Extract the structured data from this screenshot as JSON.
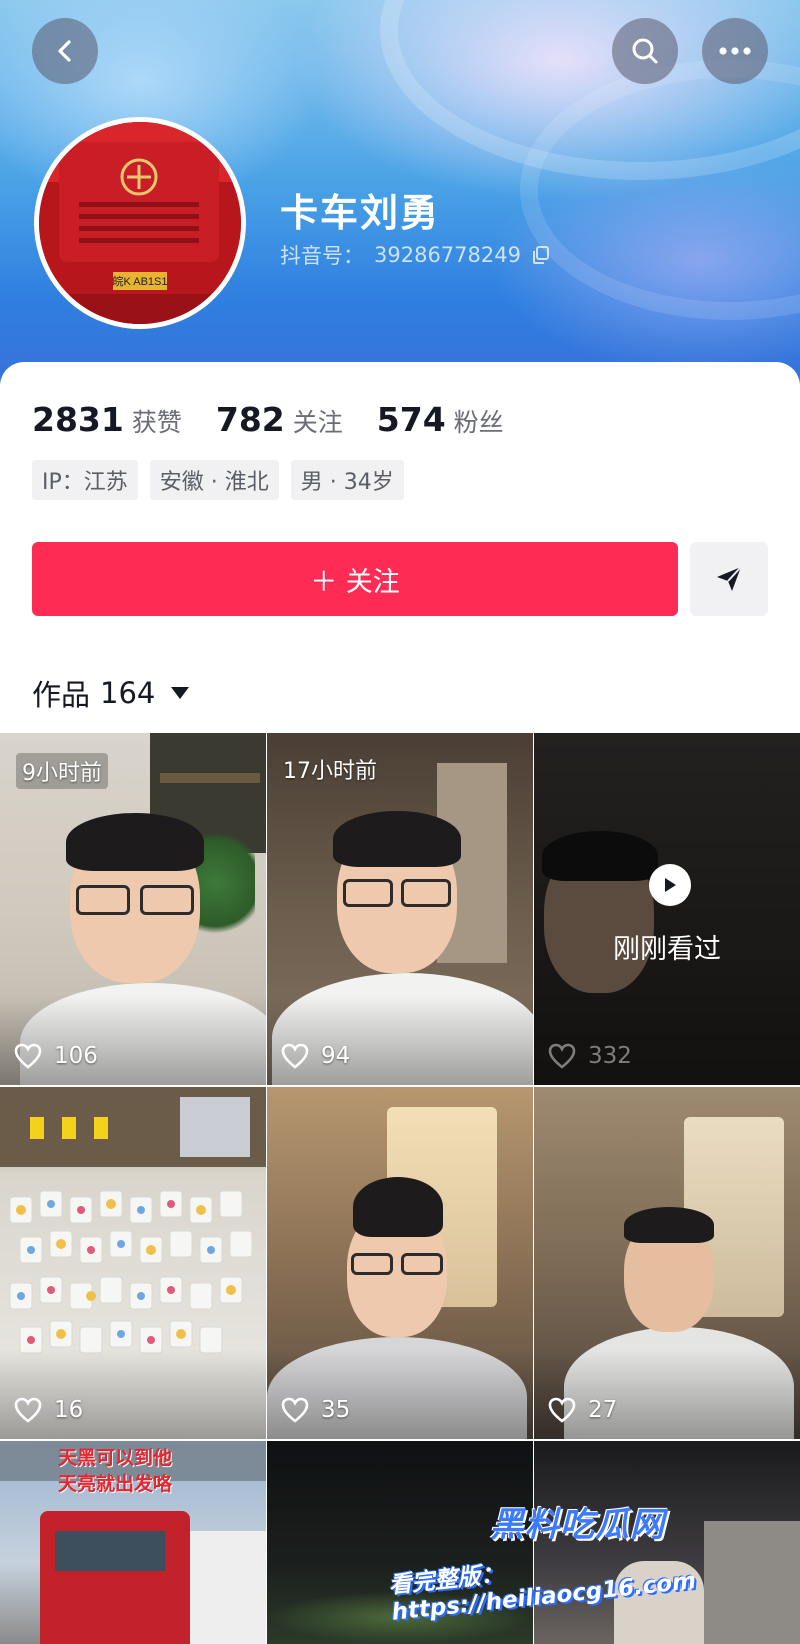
{
  "profile": {
    "nickname": "卡车刘勇",
    "account_label": "抖音号：",
    "account_id": "39286778249",
    "plate_text": "皖K AB1S1"
  },
  "stats": [
    {
      "value": "2831",
      "label": "获赞"
    },
    {
      "value": "782",
      "label": "关注"
    },
    {
      "value": "574",
      "label": "粉丝"
    }
  ],
  "tags": [
    "IP：江苏",
    "安徽 · 淮北",
    "男 · 34岁"
  ],
  "actions": {
    "follow_label": "＋ 关注"
  },
  "works": {
    "label": "作品",
    "count": "164"
  },
  "videos": [
    {
      "time": "9小时前",
      "likes": "106"
    },
    {
      "time": "17小时前",
      "likes": "94"
    },
    {
      "time": "",
      "likes": "332",
      "watched_label": "刚刚看过"
    },
    {
      "time": "",
      "likes": "16"
    },
    {
      "time": "",
      "likes": "35"
    },
    {
      "time": "",
      "likes": "27"
    },
    {
      "caption_line1": "天黑可以到他",
      "caption_line2": "天亮就出发咯"
    },
    {},
    {}
  ],
  "watermark": {
    "brand": "黑料吃瓜网",
    "url_text": "看完整版：https://heiliaocg16.com"
  },
  "colors": {
    "accent": "#fe2c55",
    "banner_blue": "#2f7fe0",
    "watermark_blue": "#3c7bff"
  },
  "icons": [
    "back-icon",
    "search-icon",
    "more-icon",
    "copy-icon",
    "share-send-icon",
    "heart-icon",
    "play-icon"
  ]
}
